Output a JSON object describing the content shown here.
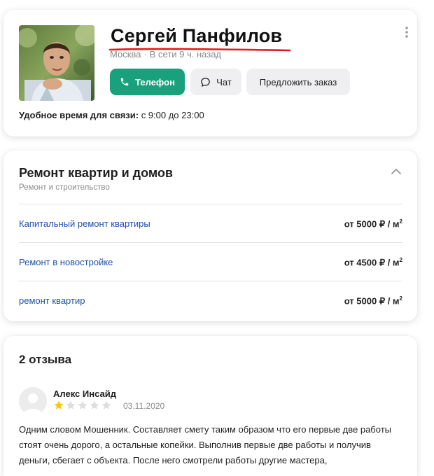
{
  "profile": {
    "name": "Сергей Панфилов",
    "city": "Москва",
    "online": "В сети 9 ч. назад",
    "phone_label": "Телефон",
    "chat_label": "Чат",
    "order_label": "Предложить заказ",
    "contact_time_label": "Удобное время для связи:",
    "contact_time_value": "с 9:00 до 23:00",
    "underline_color": "#e3191c",
    "accent_color": "#18a17c"
  },
  "services": {
    "title": "Ремонт квартир и домов",
    "subtitle": "Ремонт и строительство",
    "items": [
      {
        "name": "Капитальный ремонт квартиры",
        "price": "от 5000 ₽ / м",
        "unit_sup": "2"
      },
      {
        "name": "Ремонт в новостройке",
        "price": "от 4500 ₽ / м",
        "unit_sup": "2"
      },
      {
        "name": "ремонт квартир",
        "price": "от 5000 ₽ / м",
        "unit_sup": "2"
      }
    ]
  },
  "reviews": {
    "title": "2 отзыва",
    "items": [
      {
        "author": "Алекс Инсайд",
        "rating": 1,
        "max_rating": 5,
        "date": "03.11.2020",
        "text": "Одним словом Мошенник. Составляет смету таким образом что его первые две работы стоят очень дорого, а остальные копейки. Выполнив первые две работы и получив деньги, сбегает с объекта. После него смотрели работы другие мастера,"
      }
    ]
  },
  "icons": {
    "more": "more-vertical-icon",
    "phone": "phone-icon",
    "chat": "chat-bubble-icon",
    "collapse": "chevron-up-icon",
    "star": "star-icon",
    "avatar_placeholder": "user-avatar-icon"
  }
}
